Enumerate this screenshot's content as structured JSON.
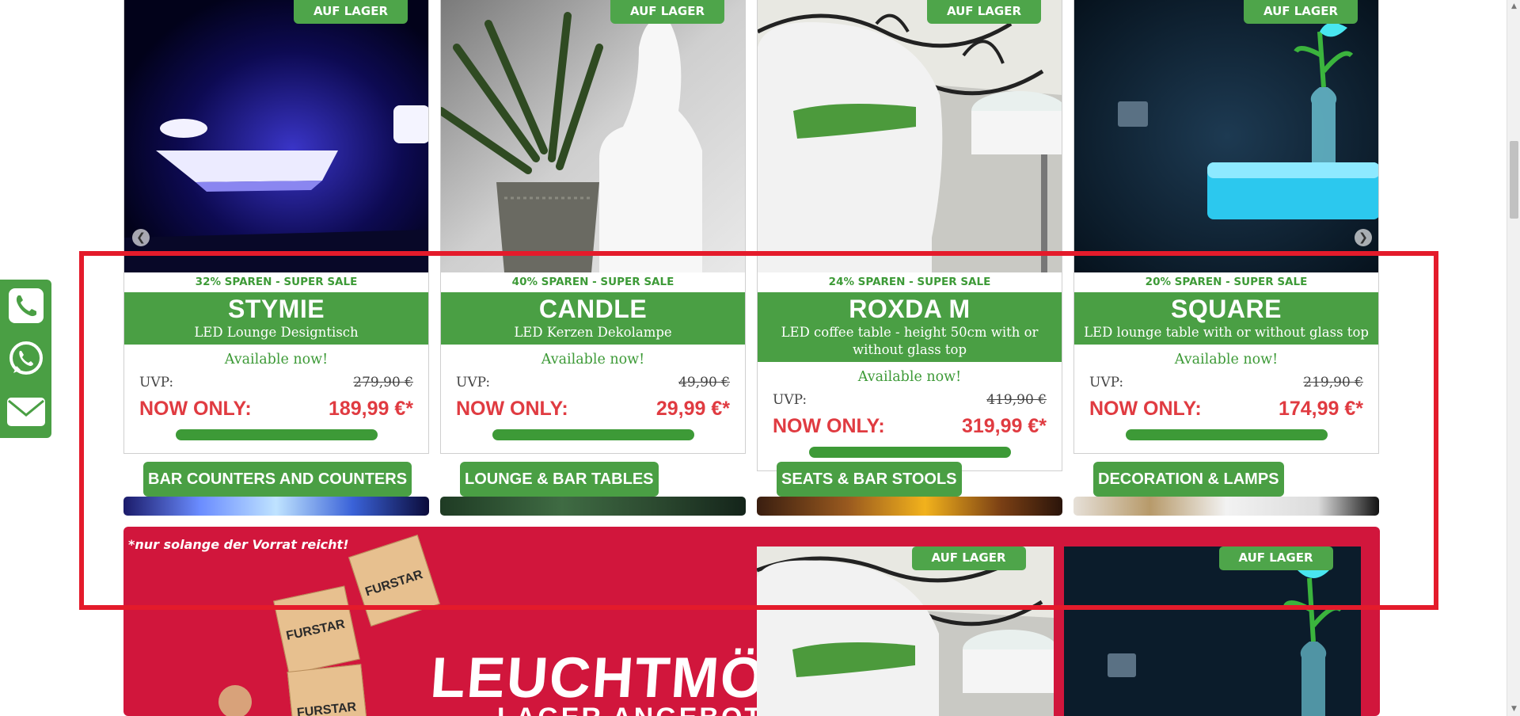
{
  "cards": [
    {
      "badge": "AUF LAGER",
      "sale": "32% SPAREN - SUPER SALE",
      "name": "STYMIE",
      "subtitle": "LED Lounge Designtisch",
      "availability": "Available now!",
      "uvp_label": "UVP:",
      "uvp_price": "279,90 €",
      "now_label": "NOW ONLY:",
      "now_price": "189,99 €*"
    },
    {
      "badge": "AUF LAGER",
      "sale": "40% SPAREN - SUPER SALE",
      "name": "CANDLE",
      "subtitle": "LED Kerzen Dekolampe",
      "availability": "Available now!",
      "uvp_label": "UVP:",
      "uvp_price": "49,90 €",
      "now_label": "NOW ONLY:",
      "now_price": "29,99 €*"
    },
    {
      "badge": "AUF LAGER",
      "sale": "24% SPAREN - SUPER SALE",
      "name": "ROXDA M",
      "subtitle": "LED coffee table - height 50cm with or without glass top",
      "availability": "Available now!",
      "uvp_label": "UVP:",
      "uvp_price": "419,90 €",
      "now_label": "NOW ONLY:",
      "now_price": "319,99 €*"
    },
    {
      "badge": "AUF LAGER",
      "sale": "20% SPAREN - SUPER SALE",
      "name": "SQUARE",
      "subtitle": "LED lounge table with or without glass top",
      "availability": "Available now!",
      "uvp_label": "UVP:",
      "uvp_price": "219,90 €",
      "now_label": "NOW ONLY:",
      "now_price": "174,99 €*"
    }
  ],
  "carousel": {
    "prev_icon": "chevron-left-icon",
    "next_icon": "chevron-right-icon"
  },
  "categories": [
    "BAR COUNTERS AND COUNTERS",
    "LOUNGE & BAR TABLES",
    "SEATS & BAR STOOLS",
    "DECORATION & LAMPS"
  ],
  "banner": {
    "note": "*nur solange der Vorrat reicht!",
    "title": "LEUCHTMÖBI",
    "subtitle": "LAGER ANGEBOTE",
    "box_brand": "FURSTAR",
    "mini_badges": [
      "AUF LAGER",
      "AUF LAGER"
    ]
  },
  "contact": {
    "icons": [
      "phone-icon",
      "whatsapp-icon",
      "mail-icon"
    ]
  },
  "colors": {
    "green": "#4a9f44",
    "red_price": "#e03b41",
    "banner_red": "#d1163c",
    "highlight": "#e41b2b"
  }
}
